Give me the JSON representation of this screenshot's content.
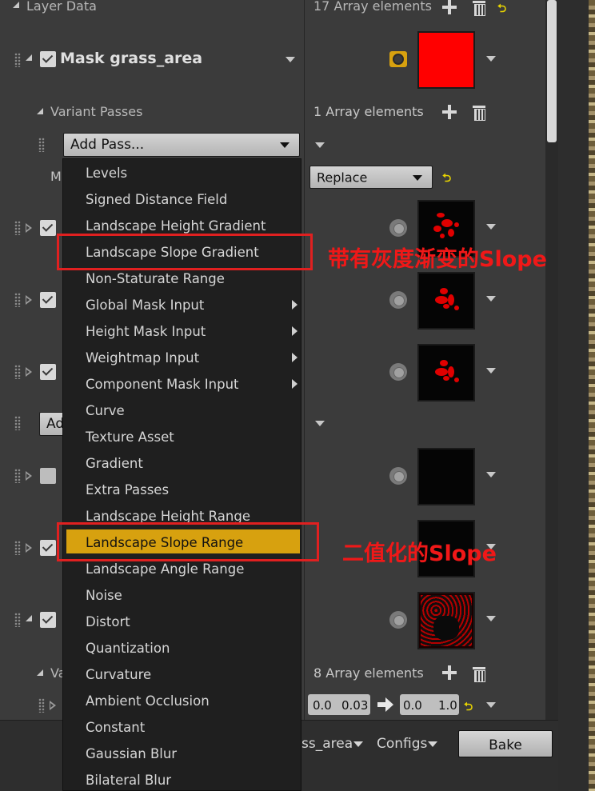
{
  "layer_data": {
    "title": "Layer Data",
    "count_text": "17 Array elements"
  },
  "mask": {
    "name": "Mask grass_area",
    "variant_passes_label": "Variant Passes",
    "variant_count_text": "1 Array elements",
    "add_pass_label": "Add Pass...",
    "partial_label_m": "M",
    "partial_label_ad": "Ad",
    "partial_label_va": "Va",
    "blend_mode": "Replace",
    "color": "#ff0000"
  },
  "sub_variant_count_text": "8 Array elements",
  "range_inputs": {
    "a_min": "0.0",
    "a_max": "0.03",
    "b_min": "0.0",
    "b_max": "1.0"
  },
  "context_menu": {
    "items": [
      {
        "label": "Levels"
      },
      {
        "label": "Signed Distance Field"
      },
      {
        "label": "Landscape Height Gradient"
      },
      {
        "label": "Landscape Slope Gradient"
      },
      {
        "label": "Non-Staturate Range"
      },
      {
        "label": "Global Mask Input",
        "submenu": true
      },
      {
        "label": "Height Mask Input",
        "submenu": true
      },
      {
        "label": "Weightmap Input",
        "submenu": true
      },
      {
        "label": "Component Mask Input",
        "submenu": true
      },
      {
        "label": "Curve"
      },
      {
        "label": "Texture Asset"
      },
      {
        "label": "Gradient"
      },
      {
        "label": "Extra Passes"
      },
      {
        "label": "Landscape Height Range"
      },
      {
        "label": "Landscape Slope Range",
        "selected": true
      },
      {
        "label": "Landscape Angle Range"
      },
      {
        "label": "Noise"
      },
      {
        "label": "Distort"
      },
      {
        "label": "Quantization"
      },
      {
        "label": "Curvature"
      },
      {
        "label": "Ambient Occlusion"
      },
      {
        "label": "Constant"
      },
      {
        "label": "Gaussian Blur"
      },
      {
        "label": "Bilateral Blur"
      }
    ],
    "selected_color": "#d7a10f"
  },
  "annotations": {
    "slope_gradient_note": "带有灰度渐变的Slope",
    "slope_range_note": "二值化的Slope",
    "color": "#f01818"
  },
  "bottom_bar": {
    "layer_dropdown_partial": "ss_area",
    "configs_label": "Configs",
    "bake_label": "Bake"
  },
  "undo_glyph": "⮌"
}
